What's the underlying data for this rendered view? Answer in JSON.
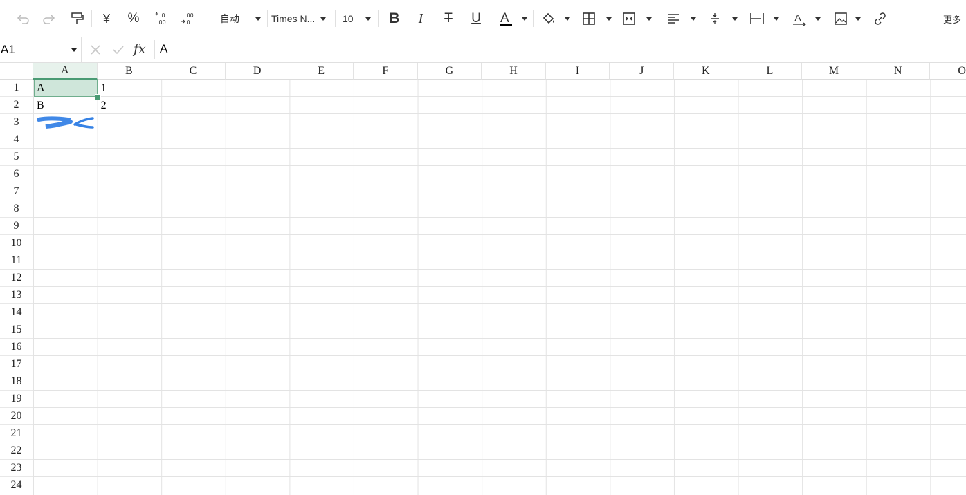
{
  "toolbar": {
    "number_format_label": "自动",
    "font_family_label": "Times N...",
    "font_size_label": "10",
    "more_label": "更多"
  },
  "formula_bar": {
    "cell_ref": "A1",
    "fx_label": "fx",
    "formula_value": "A"
  },
  "sheet": {
    "columns": [
      "A",
      "B",
      "C",
      "D",
      "E",
      "F",
      "G",
      "H",
      "I",
      "J",
      "K",
      "L",
      "M",
      "N",
      "O"
    ],
    "rows": [
      "1",
      "2",
      "3",
      "4",
      "5",
      "6",
      "7",
      "8",
      "9",
      "10",
      "11",
      "12",
      "13",
      "14",
      "15",
      "16",
      "17",
      "18",
      "19",
      "20",
      "21",
      "22",
      "23",
      "24"
    ],
    "cells": {
      "A1": "A",
      "B1": "1",
      "A2": "B",
      "B2": "2"
    },
    "selected_cell": "A1",
    "selection_color": "#cfe6da",
    "accent_color": "#4a9b74"
  },
  "annotations": {
    "scribble_color": "#2b7be4"
  }
}
